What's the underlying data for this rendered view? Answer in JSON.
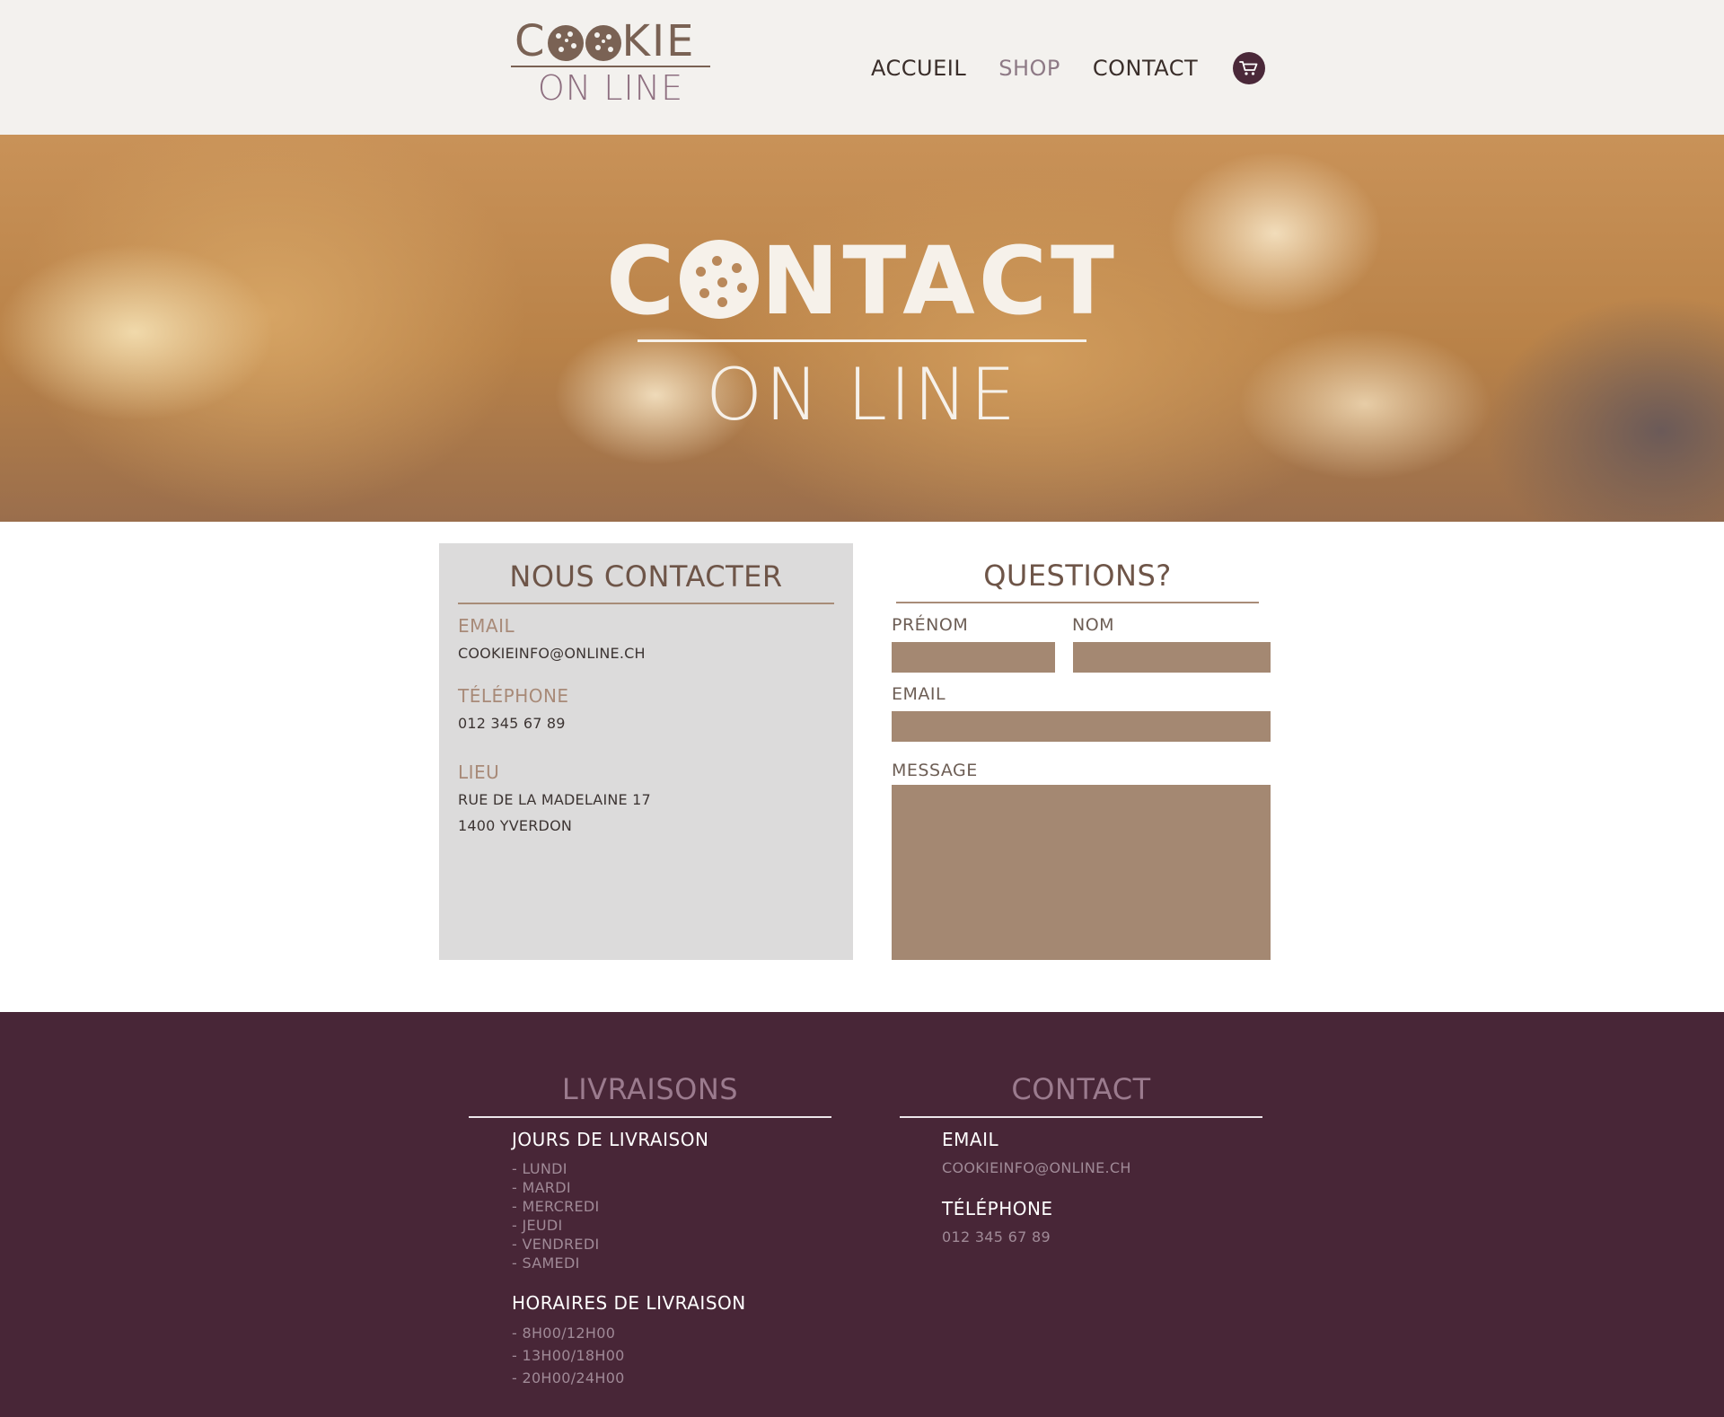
{
  "brand": {
    "logo_top_pre": "C",
    "logo_top_post": "KIE",
    "logo_bottom": "ON LINE",
    "colors": {
      "primary_brown": "#7a6254",
      "accent_plum": "#482637",
      "input_fill": "#a48872",
      "panel_grey": "#dcdbdb"
    }
  },
  "nav": {
    "items": [
      {
        "label": "ACCUEIL",
        "active": false
      },
      {
        "label": "SHOP",
        "active": true
      },
      {
        "label": "CONTACT",
        "active": false
      }
    ],
    "cart_icon": "cart-icon"
  },
  "hero": {
    "title_pre": "C",
    "title_post": "NTACT",
    "subtitle": "ON LINE"
  },
  "contact_panel": {
    "title": "NOUS CONTACTER",
    "email_label": "EMAIL",
    "email_value": "COOKIEINFO@ONLINE.CH",
    "phone_label": "TÉLÉPHONE",
    "phone_value": "012 345 67 89",
    "place_label": "LIEU",
    "address_line1": "RUE DE LA MADELAINE 17",
    "address_line2": "1400 YVERDON"
  },
  "form": {
    "title": "QUESTIONS?",
    "firstname_label": "PRÉNOM",
    "firstname_value": "",
    "lastname_label": "NOM",
    "lastname_value": "",
    "email_label": "EMAIL",
    "email_value": "",
    "message_label": "MESSAGE",
    "message_value": ""
  },
  "footer": {
    "deliveries": {
      "title": "LIVRAISONS",
      "days_heading": "JOURS DE LIVRAISON",
      "days": [
        "- LUNDI",
        "- MARDI",
        "- MERCREDI",
        "- JEUDI",
        "- VENDREDI",
        "- SAMEDI"
      ],
      "hours_heading": "HORAIRES DE LIVRAISON",
      "hours": [
        "- 8H00/12H00",
        "- 13H00/18H00",
        "- 20H00/24H00"
      ]
    },
    "contact": {
      "title": "CONTACT",
      "email_heading": "EMAIL",
      "email_value": "COOKIEINFO@ONLINE.CH",
      "phone_heading": "TÉLÉPHONE",
      "phone_value": "012 345 67 89"
    }
  }
}
